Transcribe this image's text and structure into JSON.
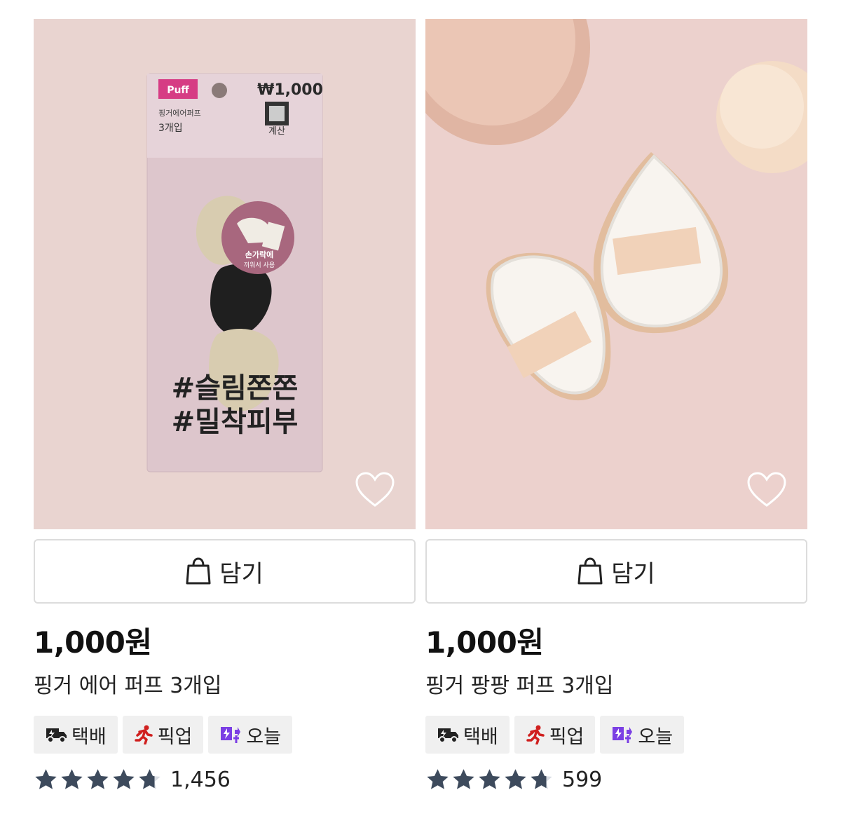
{
  "products": [
    {
      "package": {
        "badge": "Puff",
        "price_tag": "₩1,000",
        "line1": "핑거에어퍼프",
        "line2": "3개입",
        "checkout": "계산",
        "finger_text1": "손가락에",
        "finger_text2": "끼워서 사용",
        "hashtag1": "#슬림쫀쫀",
        "hashtag2": "#밀착피부"
      },
      "cart_label": "담기",
      "price": "1,000원",
      "title": "핑거 에어 퍼프 3개입",
      "tags": [
        {
          "label": "택배",
          "icon": "delivery-truck-icon",
          "color": "#222222"
        },
        {
          "label": "픽업",
          "icon": "pickup-runner-icon",
          "color": "#d0201f"
        },
        {
          "label": "오늘",
          "icon": "today-delivery-icon",
          "color": "#7b3fe4"
        }
      ],
      "rating": 4.7,
      "review_count": "1,456"
    },
    {
      "cart_label": "담기",
      "price": "1,000원",
      "title": "핑거 팡팡 퍼프 3개입",
      "tags": [
        {
          "label": "택배",
          "icon": "delivery-truck-icon",
          "color": "#222222"
        },
        {
          "label": "픽업",
          "icon": "pickup-runner-icon",
          "color": "#d0201f"
        },
        {
          "label": "오늘",
          "icon": "today-delivery-icon",
          "color": "#7b3fe4"
        }
      ],
      "rating": 4.7,
      "review_count": "599"
    }
  ],
  "colors": {
    "star": "#3d4a5c",
    "tag_bg": "#f0f0f0",
    "border": "#dcdcdc"
  }
}
